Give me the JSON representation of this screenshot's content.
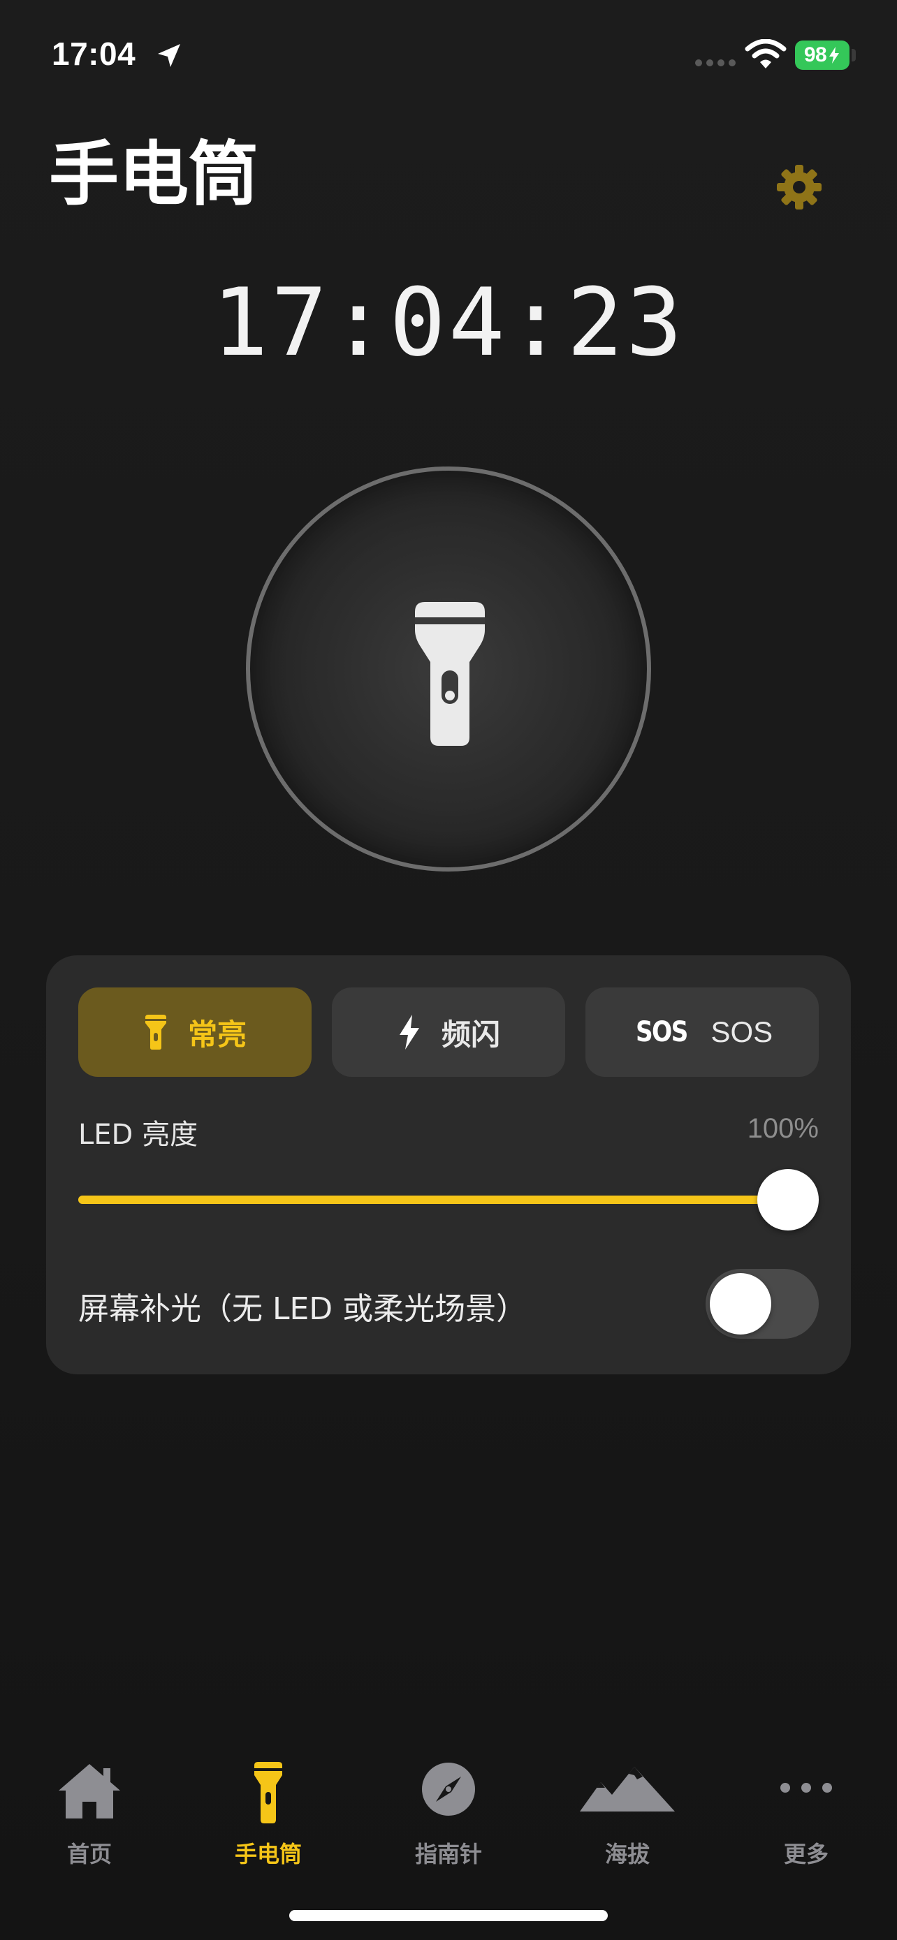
{
  "status_bar": {
    "time": "17:04",
    "battery": "98",
    "icons": [
      "location-arrow-icon",
      "signal-dots-icon",
      "wifi-icon",
      "battery-charging-icon"
    ]
  },
  "header": {
    "title": "手电筒",
    "settings_icon": "gear-icon"
  },
  "clock": {
    "time": "17:04:23"
  },
  "power_button": {
    "icon": "flashlight-icon",
    "on": false
  },
  "modes": [
    {
      "label": "常亮",
      "icon": "flashlight-small-icon",
      "active": true
    },
    {
      "label": "频闪",
      "icon": "bolt-icon",
      "active": false
    },
    {
      "label": "SOS",
      "icon_text": "SOS",
      "active": false
    }
  ],
  "led_brightness": {
    "label": "LED 亮度",
    "value_text": "100%",
    "value": 1.0
  },
  "screen_light": {
    "label": "屏幕补光（无 LED 或柔光场景）",
    "on": false
  },
  "tab_bar": {
    "items": [
      {
        "label": "首页",
        "icon": "house-icon",
        "active": false
      },
      {
        "label": "手电筒",
        "icon": "flashlight-tab-icon",
        "active": true
      },
      {
        "label": "指南针",
        "icon": "compass-icon",
        "active": false
      },
      {
        "label": "海拔",
        "icon": "mountain-icon",
        "active": false
      },
      {
        "label": "更多",
        "icon": "ellipsis-icon",
        "active": false
      }
    ]
  },
  "colors": {
    "accent": "#f5c518",
    "active_mode_bg": "#6b5a1e",
    "panel_bg": "#2b2b2b",
    "battery": "#34c759",
    "inactive_tab": "#8e8e93"
  }
}
